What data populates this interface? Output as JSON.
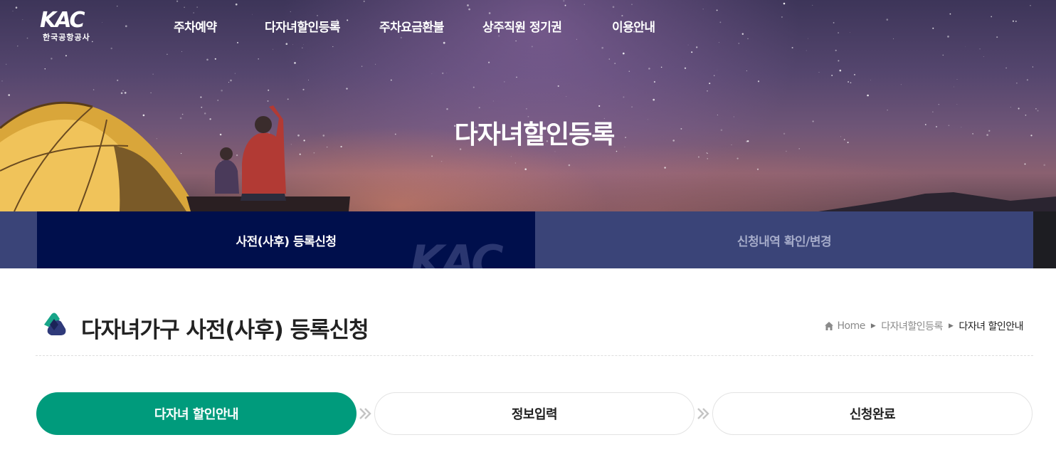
{
  "brand": {
    "logo_text": "KAC",
    "logo_sub": "한국공항공사"
  },
  "nav": {
    "items": [
      {
        "label": "주차예약"
      },
      {
        "label": "다자녀할인등록"
      },
      {
        "label": "주차요금환불"
      },
      {
        "label": "상주직원 정기권"
      },
      {
        "label": "이용안내"
      }
    ]
  },
  "hero": {
    "title": "다자녀할인등록"
  },
  "tabs": {
    "items": [
      {
        "label": "사전(사후) 등록신청",
        "active": true
      },
      {
        "label": "신청내역 확인/변경",
        "active": false
      }
    ],
    "watermark_text": "KAC"
  },
  "content": {
    "page_title": "다자녀가구 사전(사후) 등록신청",
    "breadcrumb": {
      "home": "Home",
      "level1": "다자녀할인등록",
      "current": "다자녀 할인안내"
    }
  },
  "steps": {
    "items": [
      {
        "label": "다자녀 할인안내",
        "active": true
      },
      {
        "label": "정보입력",
        "active": false
      },
      {
        "label": "신청완료",
        "active": false
      }
    ]
  },
  "colors": {
    "primary_navy": "#000f4c",
    "tab_bar": "#3a4478",
    "accent_green": "#009b7c"
  },
  "icons": {
    "home": "home-icon",
    "breadcrumb_separator": "triangle-right-icon",
    "step_separator": "double-chevron-right-icon",
    "title_mark": "kac-symbol-icon"
  }
}
